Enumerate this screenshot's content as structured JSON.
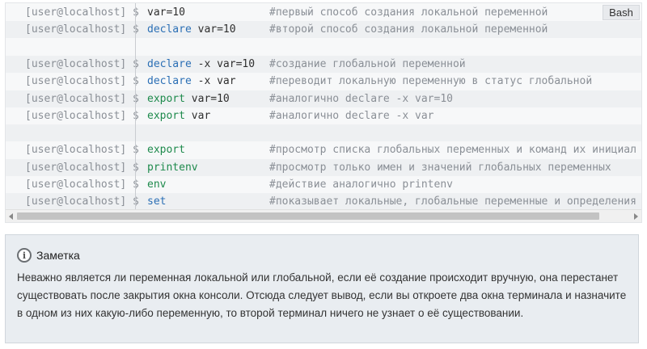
{
  "code_block": {
    "language": "Bash",
    "lines": [
      {
        "prompt": "[user@localhost] $",
        "cmd": [
          {
            "t": "var=10",
            "c": "plain"
          }
        ],
        "comment": "#первый способ создания локальной переменной"
      },
      {
        "prompt": "[user@localhost] $",
        "cmd": [
          {
            "t": "declare",
            "c": "blue"
          },
          {
            "t": " var=10",
            "c": "plain"
          }
        ],
        "comment": "#второй способ создания локальной переменной"
      },
      {
        "prompt": "",
        "cmd": [],
        "comment": ""
      },
      {
        "prompt": "[user@localhost] $",
        "cmd": [
          {
            "t": "declare",
            "c": "blue"
          },
          {
            "t": " -x var=10",
            "c": "plain"
          }
        ],
        "comment": "#создание глобальной переменной"
      },
      {
        "prompt": "[user@localhost] $",
        "cmd": [
          {
            "t": "declare",
            "c": "blue"
          },
          {
            "t": " -x var",
            "c": "plain"
          }
        ],
        "comment": "#переводит локальную переменную в статус глобальной"
      },
      {
        "prompt": "[user@localhost] $",
        "cmd": [
          {
            "t": "export",
            "c": "green"
          },
          {
            "t": " var=10",
            "c": "plain"
          }
        ],
        "comment": "#аналогично declare -x var=10"
      },
      {
        "prompt": "[user@localhost] $",
        "cmd": [
          {
            "t": "export",
            "c": "green"
          },
          {
            "t": " var",
            "c": "plain"
          }
        ],
        "comment": "#аналогично declare -x var"
      },
      {
        "prompt": "",
        "cmd": [],
        "comment": ""
      },
      {
        "prompt": "[user@localhost] $",
        "cmd": [
          {
            "t": "export",
            "c": "green"
          }
        ],
        "comment": "#просмотр списка глобальных переменных и команд их инициал"
      },
      {
        "prompt": "[user@localhost] $",
        "cmd": [
          {
            "t": "printenv",
            "c": "green"
          }
        ],
        "comment": "#просмотр только имен и значений глобальных переменных"
      },
      {
        "prompt": "[user@localhost] $",
        "cmd": [
          {
            "t": "env",
            "c": "green"
          }
        ],
        "comment": "#действие аналогично printenv"
      },
      {
        "prompt": "[user@localhost] $",
        "cmd": [
          {
            "t": "set",
            "c": "blue"
          }
        ],
        "comment": "#показывает локальные, глобальные переменные и определения"
      }
    ]
  },
  "note": {
    "title": "Заметка",
    "icon": "info-icon",
    "body": "Неважно является ли переменная локальной или глобальной, если её создание происходит вручную, она перестанет существовать после закрытия окна консоли. Отсюда следует вывод, если вы откроете два окна терминала и назначите в одном из них какую-либо переменную, то второй терминал ничего не узнает о её существовании."
  },
  "colors": {
    "keyword_blue": "#2b6fb5",
    "keyword_green": "#1e8a4c",
    "comment_gray": "#8a8f96"
  }
}
